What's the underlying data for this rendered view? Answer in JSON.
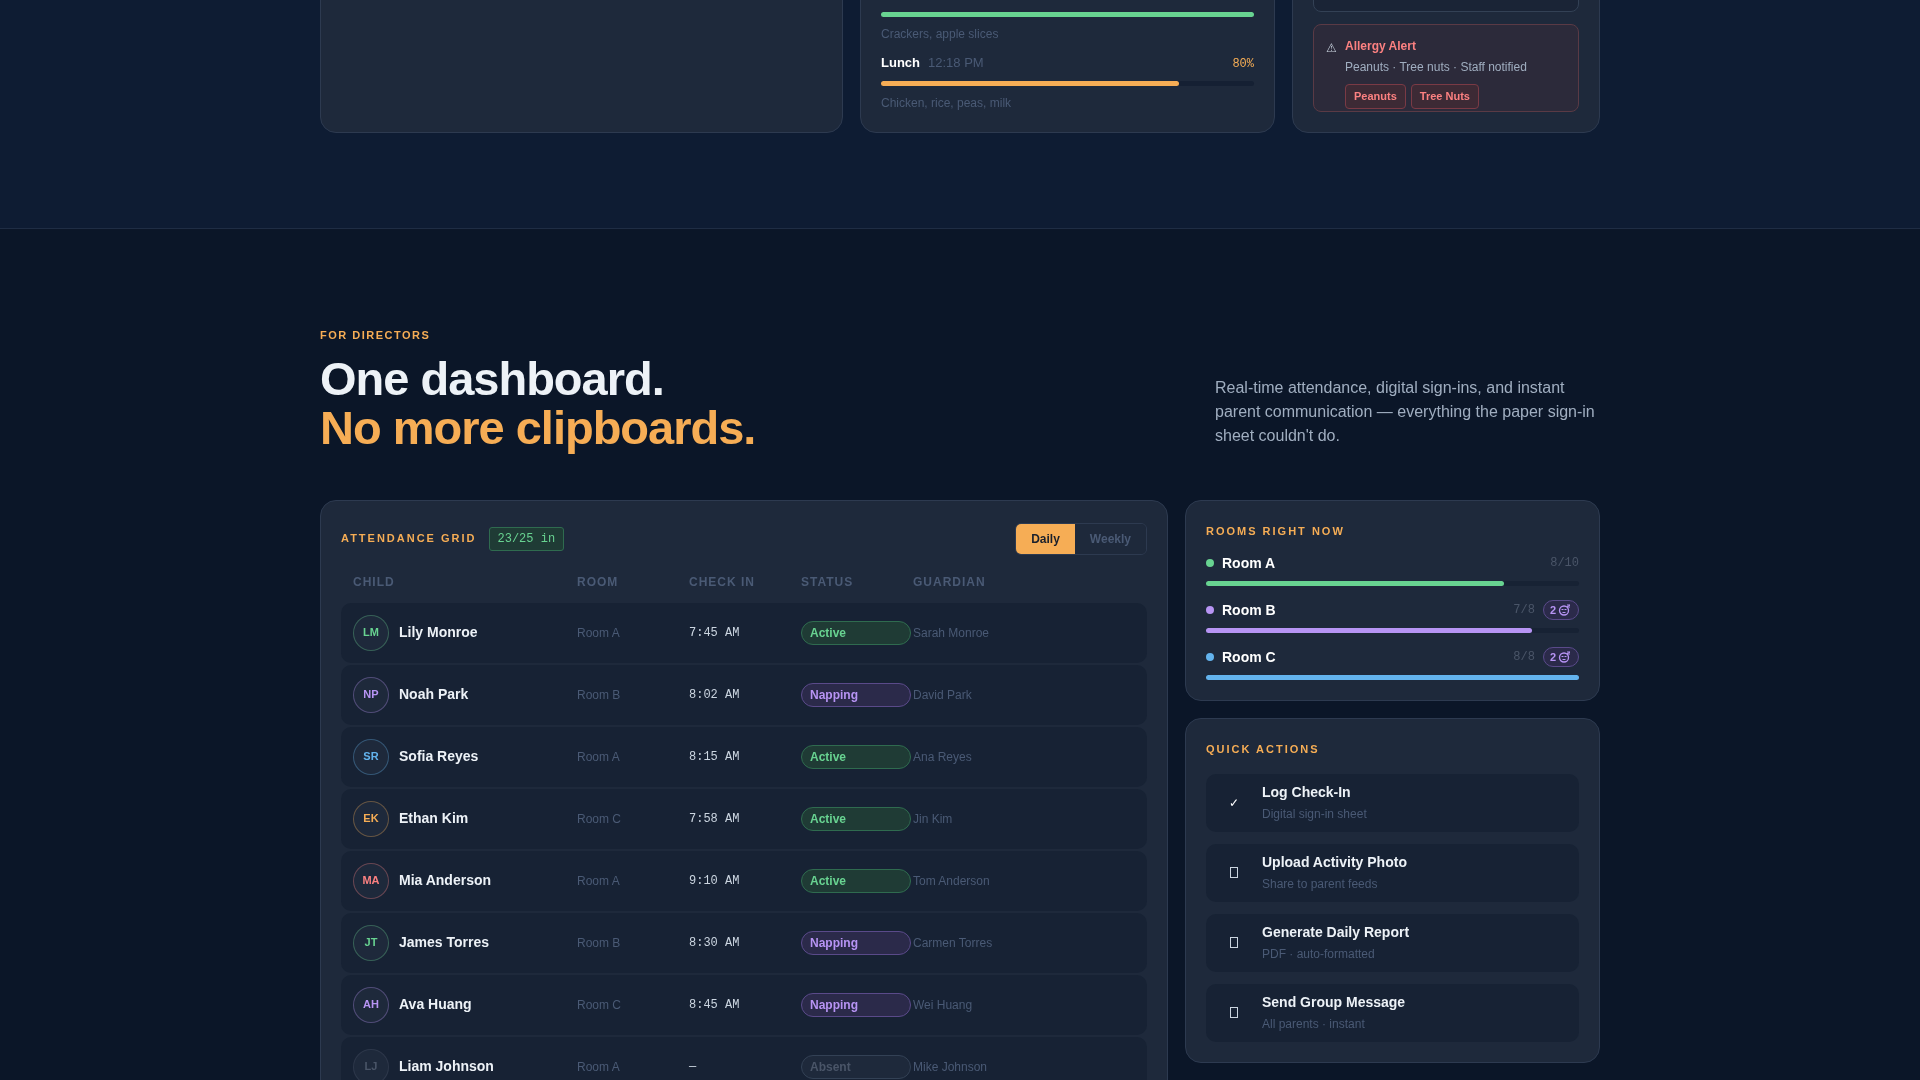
{
  "meals_card": {
    "meals": [
      {
        "note": "Crackers, apple slices",
        "level": 1,
        "color": "#68d391"
      },
      {
        "name": "Lunch",
        "time": "12:18 PM",
        "percent": "80%",
        "level": 0.8,
        "color": "#f6ad55",
        "note": "Chicken, rice, peas, milk"
      }
    ]
  },
  "allergy_alert": {
    "icon": "⚠",
    "title": "Allergy Alert",
    "text": "Peanuts · Tree nuts · Staff notified",
    "tags": [
      "Peanuts",
      "Tree Nuts"
    ]
  },
  "section": {
    "eyebrow": "FOR DIRECTORS",
    "headline": "One dashboard.",
    "headline_accent": "No more clipboards.",
    "description": "Real-time attendance, digital sign-ins, and instant parent communication — everything the paper sign-in sheet couldn't do."
  },
  "attendance": {
    "title": "ATTENDANCE GRID",
    "count": "23/25 in",
    "views": [
      {
        "label": "Daily",
        "selected": true
      },
      {
        "label": "Weekly",
        "selected": false
      }
    ],
    "columns": [
      "CHILD",
      "ROOM",
      "CHECK IN",
      "STATUS",
      "GUARDIAN"
    ],
    "rows": [
      {
        "initials": "LM",
        "name": "Lily Monroe",
        "room": "Room A",
        "check_in": "7:45 AM",
        "status": "Active",
        "kind": "active",
        "guardian": "Sarah Monroe",
        "color": "#68d391"
      },
      {
        "initials": "NP",
        "name": "Noah Park",
        "room": "Room B",
        "check_in": "8:02 AM",
        "status": "Napping",
        "kind": "napping",
        "guardian": "David Park",
        "color": "#b794f4"
      },
      {
        "initials": "SR",
        "name": "Sofia Reyes",
        "room": "Room A",
        "check_in": "8:15 AM",
        "status": "Active",
        "kind": "active",
        "guardian": "Ana Reyes",
        "color": "#63b3ed"
      },
      {
        "initials": "EK",
        "name": "Ethan Kim",
        "room": "Room C",
        "check_in": "7:58 AM",
        "status": "Active",
        "kind": "active",
        "guardian": "Jin Kim",
        "color": "#f6ad55"
      },
      {
        "initials": "MA",
        "name": "Mia Anderson",
        "room": "Room A",
        "check_in": "9:10 AM",
        "status": "Active",
        "kind": "active",
        "guardian": "Tom Anderson",
        "color": "#fc8181"
      },
      {
        "initials": "JT",
        "name": "James Torres",
        "room": "Room B",
        "check_in": "8:30 AM",
        "status": "Napping",
        "kind": "napping",
        "guardian": "Carmen Torres",
        "color": "#68d391"
      },
      {
        "initials": "AH",
        "name": "Ava Huang",
        "room": "Room C",
        "check_in": "8:45 AM",
        "status": "Napping",
        "kind": "napping",
        "guardian": "Wei Huang",
        "color": "#b794f4"
      },
      {
        "initials": "LJ",
        "name": "Liam Johnson",
        "room": "Room A",
        "check_in": "—",
        "status": "Absent",
        "kind": "absent",
        "guardian": "Mike Johnson",
        "color": "#4a5568"
      }
    ]
  },
  "rooms": {
    "title": "ROOMS RIGHT NOW",
    "rooms": [
      {
        "name": "Room A",
        "color": "#68d391",
        "count": "8/10",
        "level": 0.8
      },
      {
        "name": "Room B",
        "color": "#b794f4",
        "count": "7/8",
        "level": 0.875,
        "napping": "2"
      },
      {
        "name": "Room C",
        "color": "#63b3ed",
        "count": "8/8",
        "level": 1,
        "napping": "2"
      }
    ]
  },
  "quick_actions": {
    "title": "QUICK ACTIONS",
    "actions": [
      {
        "icon": "✓",
        "title": "Log Check-In",
        "subtitle": "Digital sign-in sheet"
      },
      {
        "title": "Upload Activity Photo",
        "subtitle": "Share to parent feeds"
      },
      {
        "title": "Generate Daily Report",
        "subtitle": "PDF · auto-formatted"
      },
      {
        "title": "Send Group Message",
        "subtitle": "All parents · instant"
      }
    ]
  }
}
